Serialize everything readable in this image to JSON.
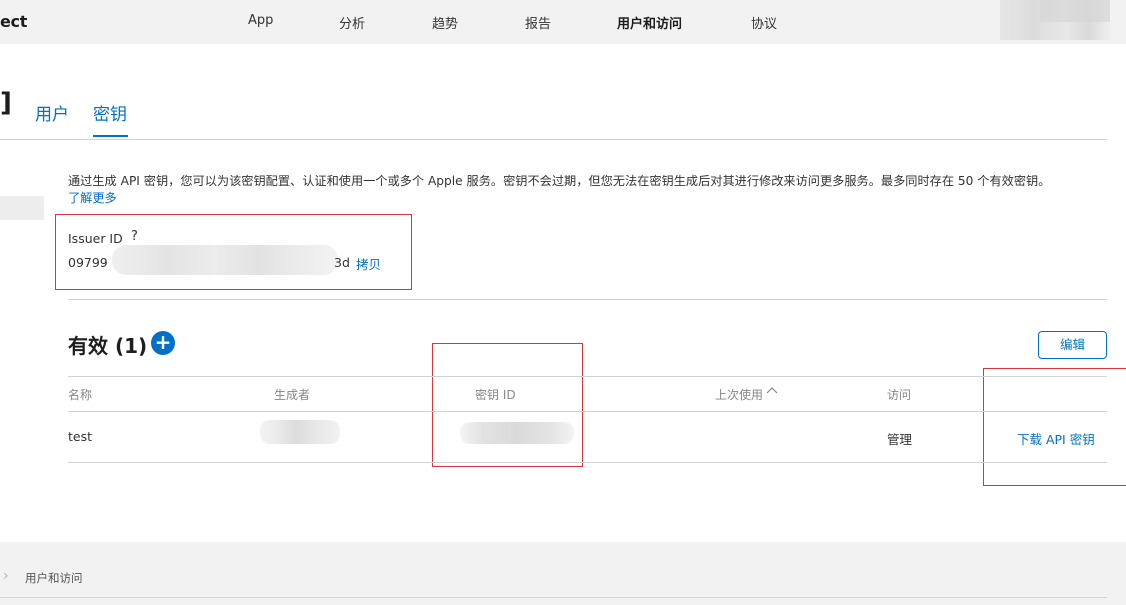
{
  "app": {
    "brand_fragment": "ect"
  },
  "nav": {
    "items": [
      {
        "label": "App"
      },
      {
        "label": "分析"
      },
      {
        "label": "趋势"
      },
      {
        "label": "报告"
      },
      {
        "label": "用户和访问"
      },
      {
        "label": "协议"
      }
    ],
    "active": "用户和访问"
  },
  "page": {
    "title_fragment": "]",
    "tabs": [
      {
        "label": "用户"
      },
      {
        "label": "密钥"
      }
    ],
    "active_tab": "密钥"
  },
  "description": {
    "text": "通过生成 API 密钥，您可以为该密钥配置、认证和使用一个或多个 Apple 服务。密钥不会过期，但您无法在密钥生成后对其进行修改来访问更多服务。最多同时存在 50 个有效密钥。",
    "learn_more": "了解更多"
  },
  "issuer": {
    "label": "Issuer ID",
    "help": "?",
    "value_prefix": "09799",
    "value_suffix": "3d",
    "copy_label": "拷贝"
  },
  "active_keys": {
    "title": "有效 (1)",
    "add_glyph": "+",
    "edit_label": "编辑",
    "columns": [
      "名称",
      "生成者",
      "密钥 ID",
      "上次使用",
      "访问"
    ],
    "sort_glyph": "^",
    "rows": [
      {
        "name": "test",
        "access": "管理",
        "action": "下载 API 密钥"
      }
    ]
  },
  "footer": {
    "chevron": "›",
    "breadcrumb": "用户和访问"
  },
  "colors": {
    "link": "#0070c9",
    "highlight_box": "#d9383a"
  }
}
